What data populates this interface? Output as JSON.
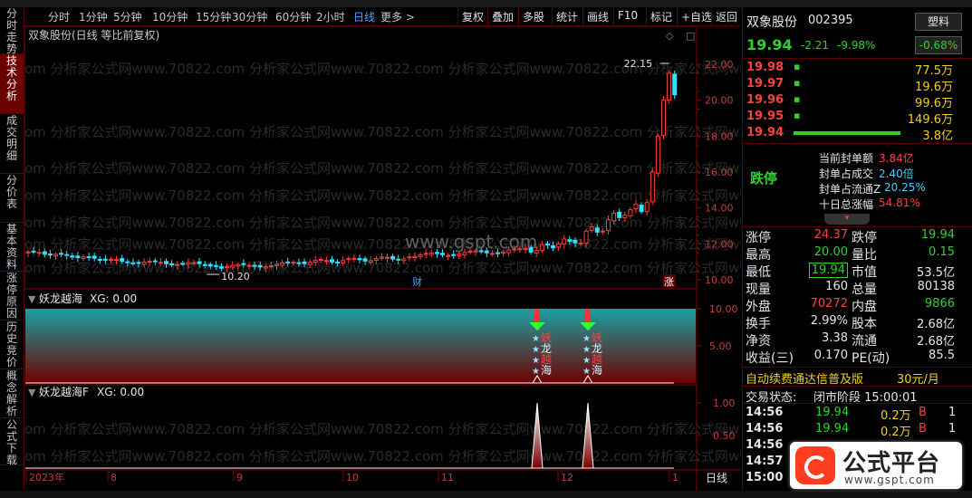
{
  "toolbar": {
    "periods": [
      "分时",
      "1分钟",
      "5分钟",
      "10分钟",
      "15分钟",
      "30分钟",
      "60分钟",
      "2小时",
      "日线",
      "更多 >"
    ],
    "active_period": "日线",
    "actions": [
      "复权",
      "叠加",
      "多股",
      "统计",
      "画线",
      "F10",
      "标记",
      "+自选",
      "返回"
    ]
  },
  "left_tabs": [
    "分时走势",
    "技术分析",
    "成交明细",
    "分价表",
    "基本资料",
    "涨停原因",
    "历史竞价",
    "概念解析",
    "公式下载"
  ],
  "active_left_tab": "技术分析",
  "main_pane": {
    "title": "双象股份(日线 等比前复权)",
    "high_label": "22.15",
    "low_label": "10.20",
    "marker_cai": "财",
    "marker_zhang": "涨",
    "watermark": "www.gspt.com",
    "watermark_bg": "om 分析家公式网www.70822.com 分析家公式网www.70822.com 分析家公式网www.70822.com 分析家公式网www.70822.c",
    "y_ticks": [
      "22.00",
      "20.00",
      "18.00",
      "16.00",
      "14.00",
      "12.00",
      "10.00"
    ]
  },
  "indicator1": {
    "title": "妖龙越海",
    "value": "XG: 0.00",
    "y_ticks": [
      "10.00",
      "5.00"
    ],
    "signal_text": [
      "妖",
      "龙",
      "越",
      "海"
    ]
  },
  "indicator2": {
    "title": "妖龙越海F",
    "value": "XG: 0.00",
    "y_ticks": [
      "1.00",
      "0.50"
    ]
  },
  "x_axis": {
    "labels": [
      "2023年",
      "8",
      "9",
      "10",
      "11",
      "12",
      "1"
    ],
    "period_label": "日线"
  },
  "stock": {
    "name": "双象股份",
    "code": "002395",
    "type_badge": "塑料",
    "price": "19.94",
    "change": "-2.21",
    "change_pct": "-9.98%",
    "badge_pct": "-0.68%"
  },
  "order_book": [
    {
      "price": "19.98",
      "vol": "77.5万"
    },
    {
      "price": "19.97",
      "vol": "19.6万"
    },
    {
      "price": "19.96",
      "vol": "99.6万"
    },
    {
      "price": "19.95",
      "vol": "149.6万"
    },
    {
      "price": "19.94",
      "vol": "3.8亿"
    }
  ],
  "limit_info": {
    "status": "跌停",
    "rows": [
      {
        "label": "当前封单额",
        "value": "3.84亿"
      },
      {
        "label": "封单占成交",
        "value": "2.40倍"
      },
      {
        "label": "封单占流通Z",
        "value": "20.25%"
      },
      {
        "label": "十日总涨幅",
        "value": "54.81%"
      }
    ]
  },
  "quote": [
    {
      "l1": "涨停",
      "v1": "24.37",
      "l2": "跌停",
      "v2": "19.94"
    },
    {
      "l1": "最高",
      "v1": "20.00",
      "l2": "量比",
      "v2": "0.15"
    },
    {
      "l1": "最低",
      "v1": "19.94",
      "l2": "市值",
      "v2": "53.5亿"
    },
    {
      "l1": "现量",
      "v1": "160",
      "l2": "总量",
      "v2": "80138"
    },
    {
      "l1": "外盘",
      "v1": "70272",
      "l2": "内盘",
      "v2": "9866"
    },
    {
      "l1": "换手",
      "v1": "2.99%",
      "l2": "股本",
      "v2": "2.68亿"
    },
    {
      "l1": "净资",
      "v1": "3.38",
      "l2": "流通",
      "v2": "2.68亿"
    },
    {
      "l1": "收益(三)",
      "v1": "0.170",
      "l2": "PE(动)",
      "v2": "85.5"
    }
  ],
  "promo": {
    "text": "自动续费通达信普及版",
    "price": "30元/月"
  },
  "trade_status": {
    "label": "交易状态:",
    "value": "闭市阶段 15:00:01"
  },
  "ticks": [
    {
      "time": "14:56",
      "price": "19.94",
      "vol": "0.2万",
      "side": "B",
      "n": "1"
    },
    {
      "time": "14:56",
      "price": "19.94",
      "vol": "0.2万",
      "side": "B",
      "n": "1"
    },
    {
      "time": "14:56",
      "price": "",
      "vol": "",
      "side": "",
      "n": ""
    },
    {
      "time": "14:57",
      "price": "",
      "vol": "",
      "side": "",
      "n": ""
    },
    {
      "time": "15:00",
      "price": "",
      "vol": "",
      "side": "",
      "n": ""
    }
  ],
  "logo": {
    "title": "公式平台",
    "url": "www.gspt.com"
  },
  "colors": {
    "up": "#ff3c3c",
    "down": "#33e0ff",
    "frame": "#8b0000",
    "indicator_top": "#1aa0a0",
    "indicator_bottom": "#700000"
  }
}
